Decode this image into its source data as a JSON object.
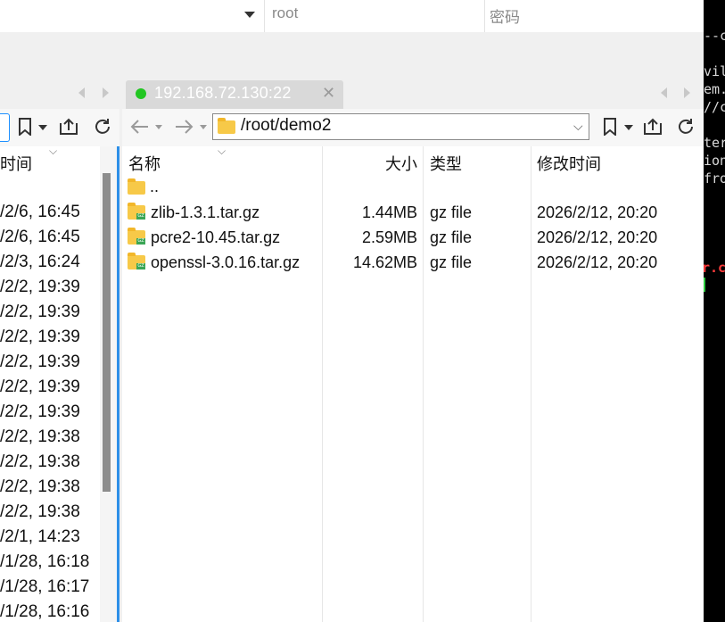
{
  "connection": {
    "user_placeholder": "root",
    "password_placeholder": "密码"
  },
  "tab": {
    "title": "192.168.72.130:22",
    "close_glyph": "✕",
    "status_color": "#22c622"
  },
  "left_pane": {
    "header_partial": "时间",
    "dates": [
      "/2/6, 16:45",
      "/2/6, 16:45",
      "/2/3, 16:24",
      "/2/2, 19:39",
      "/2/2, 19:39",
      "/2/2, 19:39",
      "/2/2, 19:39",
      "/2/2, 19:39",
      "/2/2, 19:39",
      "/2/2, 19:38",
      "/2/2, 19:38",
      "/2/2, 19:38",
      "/2/2, 19:38",
      "/2/1, 14:23",
      "/1/28, 16:18",
      "/1/28, 16:17",
      "/1/28, 16:16"
    ]
  },
  "right_pane": {
    "path": "/root/demo2",
    "columns": {
      "name": "名称",
      "size": "大小",
      "type": "类型",
      "modified": "修改时间"
    },
    "parent_entry": "..",
    "files": [
      {
        "name": "zlib-1.3.1.tar.gz",
        "size": "1.44MB",
        "type": "gz file",
        "modified": "2026/2/12, 20:20"
      },
      {
        "name": "pcre2-10.45.tar.gz",
        "size": "2.59MB",
        "type": "gz file",
        "modified": "2026/2/12, 20:20"
      },
      {
        "name": "openssl-3.0.16.tar.gz",
        "size": "14.62MB",
        "type": "gz file",
        "modified": "2026/2/12, 20:20"
      }
    ]
  },
  "terminal": {
    "lines": [
      "--c",
      "",
      "vil",
      "em.",
      "//c",
      "",
      "ter",
      "ion",
      "fro",
      "",
      "",
      "",
      "",
      "r.c"
    ],
    "highlight_color": "#ff3b3b"
  },
  "icons": {
    "back": "arrow-left-icon",
    "forward": "arrow-right-icon",
    "bookmark": "bookmark-icon",
    "upload": "upload-icon",
    "refresh": "refresh-icon",
    "folder": "folder-icon",
    "archive": "gz-archive-icon"
  }
}
